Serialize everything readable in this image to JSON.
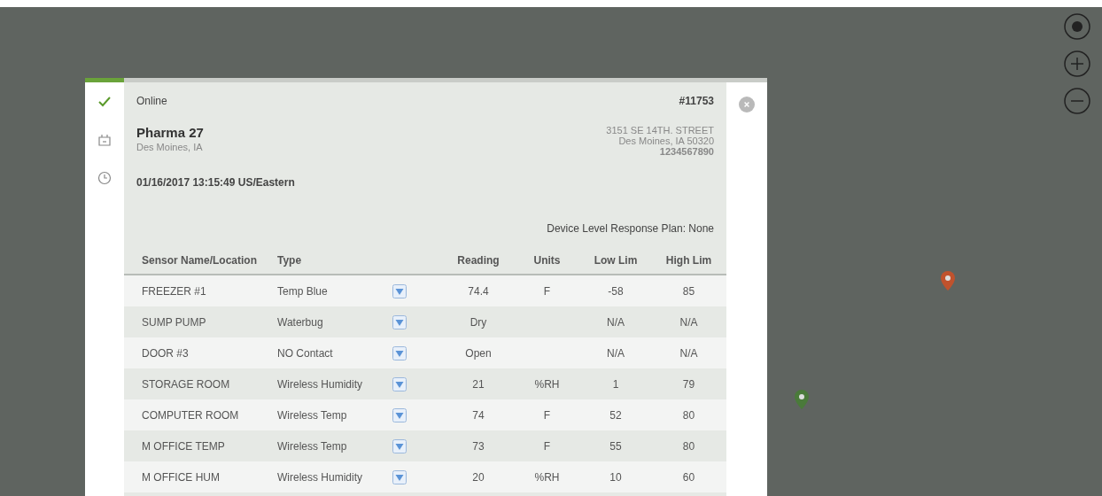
{
  "map_controls": [
    {
      "kind": "locate"
    },
    {
      "kind": "zoom_in"
    },
    {
      "kind": "zoom_out"
    }
  ],
  "map_pins": [
    {
      "color": "#c0522d"
    },
    {
      "color": "#4a7a3a"
    }
  ],
  "status": {
    "label": "Online",
    "online": true
  },
  "device_number": "#11753",
  "site": {
    "name": "Pharma 27",
    "city": "Des Moines, IA"
  },
  "address": {
    "street": "3151 SE 14TH. STREET",
    "city": "Des Moines, IA 50320",
    "phone": "1234567890"
  },
  "timestamp": "01/16/2017 13:15:49 US/Eastern",
  "response_plan": "Device Level Response Plan: None",
  "table": {
    "columns": [
      "Sensor Name/Location",
      "Type",
      "Reading",
      "Units",
      "Low Lim",
      "High Lim"
    ],
    "rows": [
      {
        "name": "FREEZER #1",
        "type": "Temp Blue",
        "reading": "74.4",
        "units": "F",
        "low": "-58",
        "high": "85"
      },
      {
        "name": "SUMP PUMP",
        "type": "Waterbug",
        "reading": "Dry",
        "units": "",
        "low": "N/A",
        "high": "N/A"
      },
      {
        "name": "DOOR #3",
        "type": "NO Contact",
        "reading": "Open",
        "units": "",
        "low": "N/A",
        "high": "N/A"
      },
      {
        "name": "STORAGE ROOM",
        "type": "Wireless Humidity",
        "reading": "21",
        "units": "%RH",
        "low": "1",
        "high": "79"
      },
      {
        "name": "COMPUTER ROOM",
        "type": "Wireless Temp",
        "reading": "74",
        "units": "F",
        "low": "52",
        "high": "80"
      },
      {
        "name": "M OFFICE TEMP",
        "type": "Wireless Temp",
        "reading": "73",
        "units": "F",
        "low": "55",
        "high": "80"
      },
      {
        "name": "M OFFICE HUM",
        "type": "Wireless Humidity",
        "reading": "20",
        "units": "%RH",
        "low": "10",
        "high": "60"
      }
    ]
  }
}
